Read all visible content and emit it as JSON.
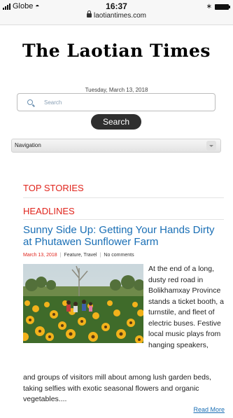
{
  "status_bar": {
    "carrier": "Globe",
    "time": "16:37",
    "url": "laotiantimes.com"
  },
  "masthead": {
    "title": "The Laotian Times"
  },
  "date": "Tuesday, March 13, 2018",
  "search": {
    "placeholder": "Search",
    "button_label": "Search"
  },
  "navigation": {
    "selected": "Navigation"
  },
  "sections": {
    "top_stories": "TOP STORIES",
    "headlines": "HEADLINES"
  },
  "article": {
    "title": "Sunny Side Up: Getting Your Hands Dirty at Phutawen Sunflower Farm",
    "date": "March 13, 2018",
    "categories": "Feature, Travel",
    "comments": "No comments",
    "excerpt_right": "At the end of a long, dusty red road in Bolikhamxay Province stands a ticket booth, a turnstile, and fleet of electric buses. Festive local music plays from hanging speakers,",
    "excerpt_bottom": "and groups of visitors mill about among lush garden beds, taking selfies with exotic seasonal flowers and organic vegetables....",
    "read_more": "Read More"
  },
  "colors": {
    "accent_red": "#e0241c",
    "link_blue": "#1a6fb5",
    "button_dark": "#2f2f2f"
  },
  "icons": {
    "search": "search-icon",
    "lock": "lock-icon",
    "wifi": "wifi-icon",
    "battery": "battery-icon",
    "bluetooth": "bluetooth-icon"
  }
}
